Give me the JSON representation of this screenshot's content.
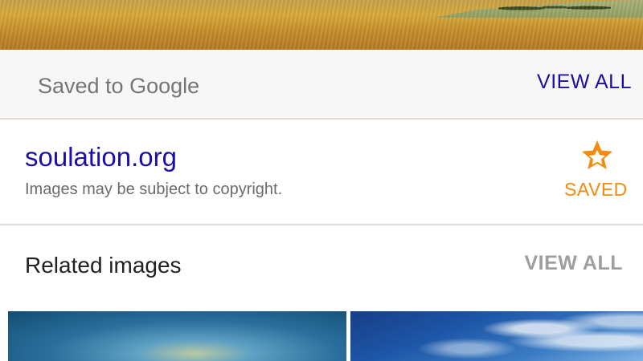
{
  "saved_bar": {
    "label": "Saved to Google",
    "view_all": "VIEW ALL"
  },
  "source": {
    "domain": "soulation.org",
    "copyright_note": "Images may be subject to copyright.",
    "saved_label": "SAVED",
    "saved_icon": "star-icon"
  },
  "related": {
    "title": "Related images",
    "view_all": "VIEW ALL"
  },
  "colors": {
    "link_blue": "#1a0dab",
    "saved_orange": "#f28c0f",
    "muted_gray": "#9e9e9e"
  }
}
